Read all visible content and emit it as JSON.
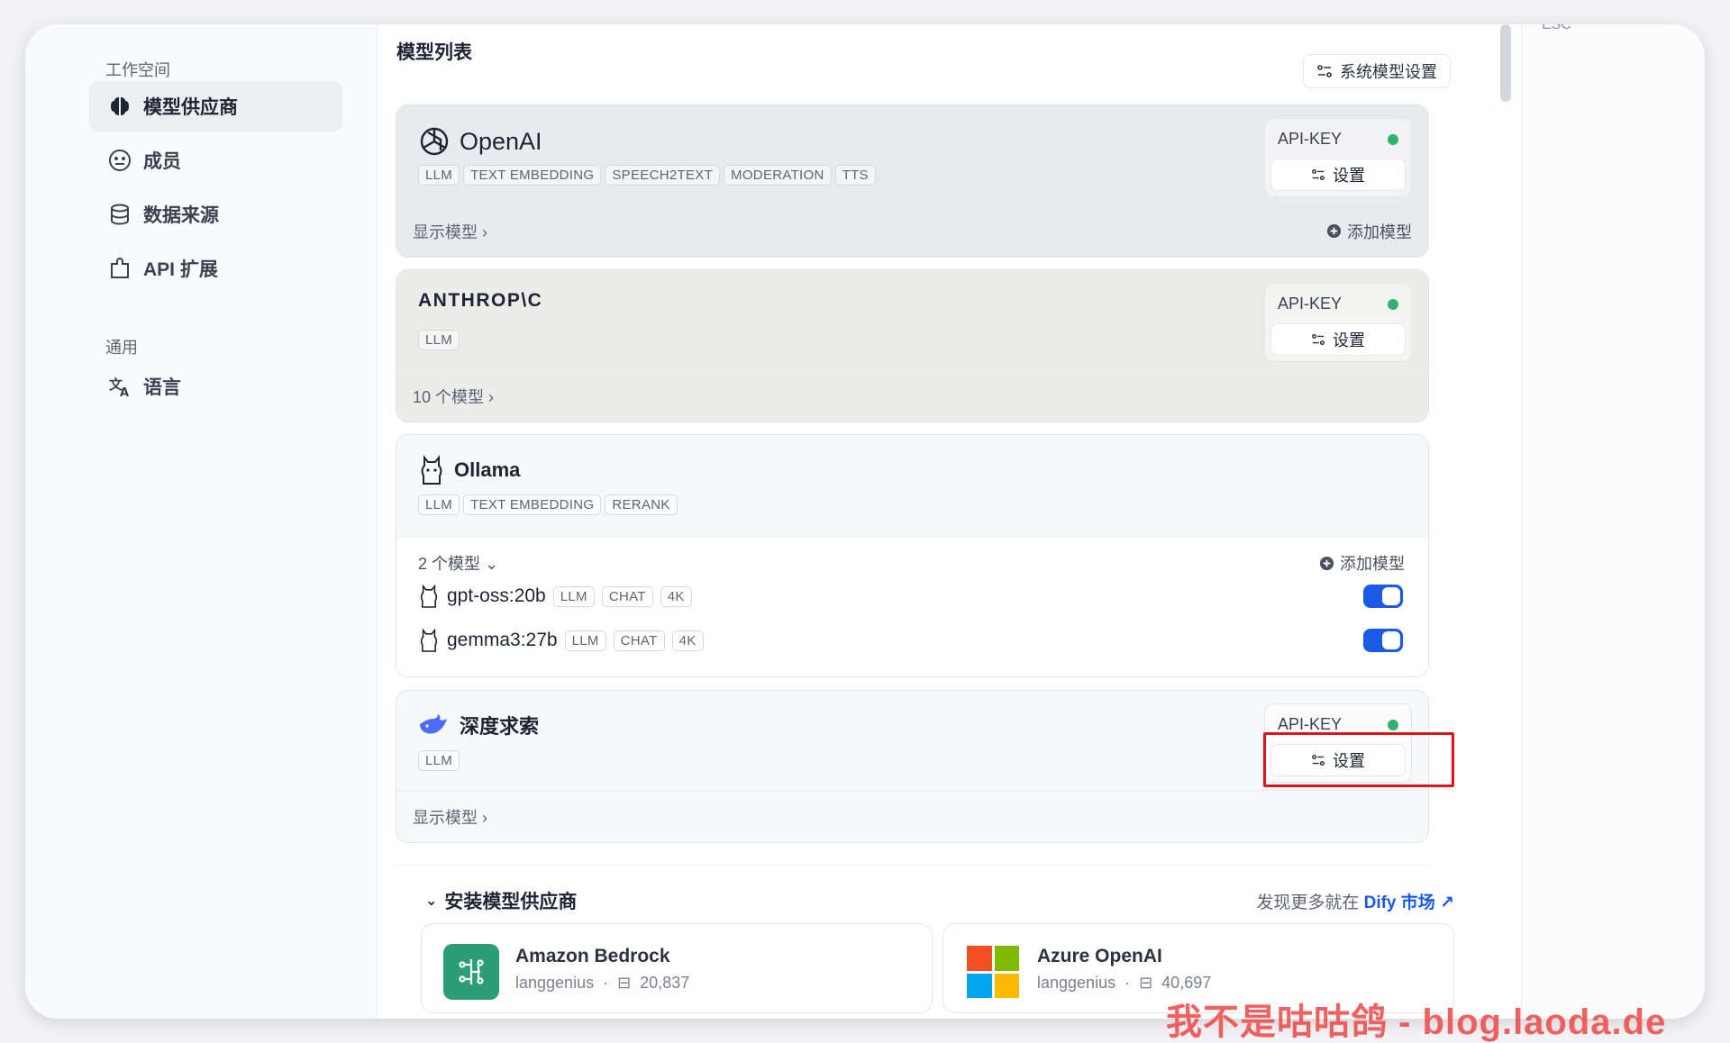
{
  "sidebar": {
    "workspace_label": "工作空间",
    "general_label": "通用",
    "items": [
      {
        "label": "模型供应商",
        "icon": "brain-icon",
        "active": true
      },
      {
        "label": "成员",
        "icon": "members-icon"
      },
      {
        "label": "数据来源",
        "icon": "database-icon"
      },
      {
        "label": "API 扩展",
        "icon": "puzzle-icon"
      }
    ],
    "general_items": [
      {
        "label": "语言",
        "icon": "translate-icon"
      }
    ]
  },
  "esc_label": "ESC",
  "main": {
    "title": "模型列表",
    "system_settings": "系统模型设置",
    "providers": [
      {
        "name": "OpenAI",
        "tags": [
          "LLM",
          "TEXT EMBEDDING",
          "SPEECH2TEXT",
          "MODERATION",
          "TTS"
        ],
        "key_label": "API-KEY",
        "set_label": "设置",
        "footer_left": "显示模型",
        "footer_right": "添加模型"
      },
      {
        "name": "ANTHROP\\C",
        "tags": [
          "LLM"
        ],
        "key_label": "API-KEY",
        "set_label": "设置",
        "footer_left": "10 个模型"
      },
      {
        "name": "Ollama",
        "tags": [
          "LLM",
          "TEXT EMBEDDING",
          "RERANK"
        ],
        "models_count": "2 个模型",
        "add_model": "添加模型",
        "models": [
          {
            "name": "gpt-oss:20b",
            "tags": [
              "LLM",
              "CHAT",
              "4K"
            ],
            "enabled": true
          },
          {
            "name": "gemma3:27b",
            "tags": [
              "LLM",
              "CHAT",
              "4K"
            ],
            "enabled": true
          }
        ]
      },
      {
        "name": "深度求索",
        "tags": [
          "LLM"
        ],
        "key_label": "API-KEY",
        "set_label": "设置",
        "footer_left": "显示模型"
      }
    ],
    "install_title": "安装模型供应商",
    "discover_prefix": "发现更多就在",
    "discover_link": "Dify 市场",
    "install_cards": [
      {
        "name": "Amazon Bedrock",
        "author": "langgenius",
        "downloads": "20,837"
      },
      {
        "name": "Azure OpenAI",
        "author": "langgenius",
        "downloads": "40,697"
      }
    ]
  },
  "watermark": "我不是咕咕鸽 - blog.laoda.de",
  "colors": {
    "accent": "#1b5ae6",
    "status_ok": "#2fb36c",
    "highlight": "#e0131a"
  }
}
